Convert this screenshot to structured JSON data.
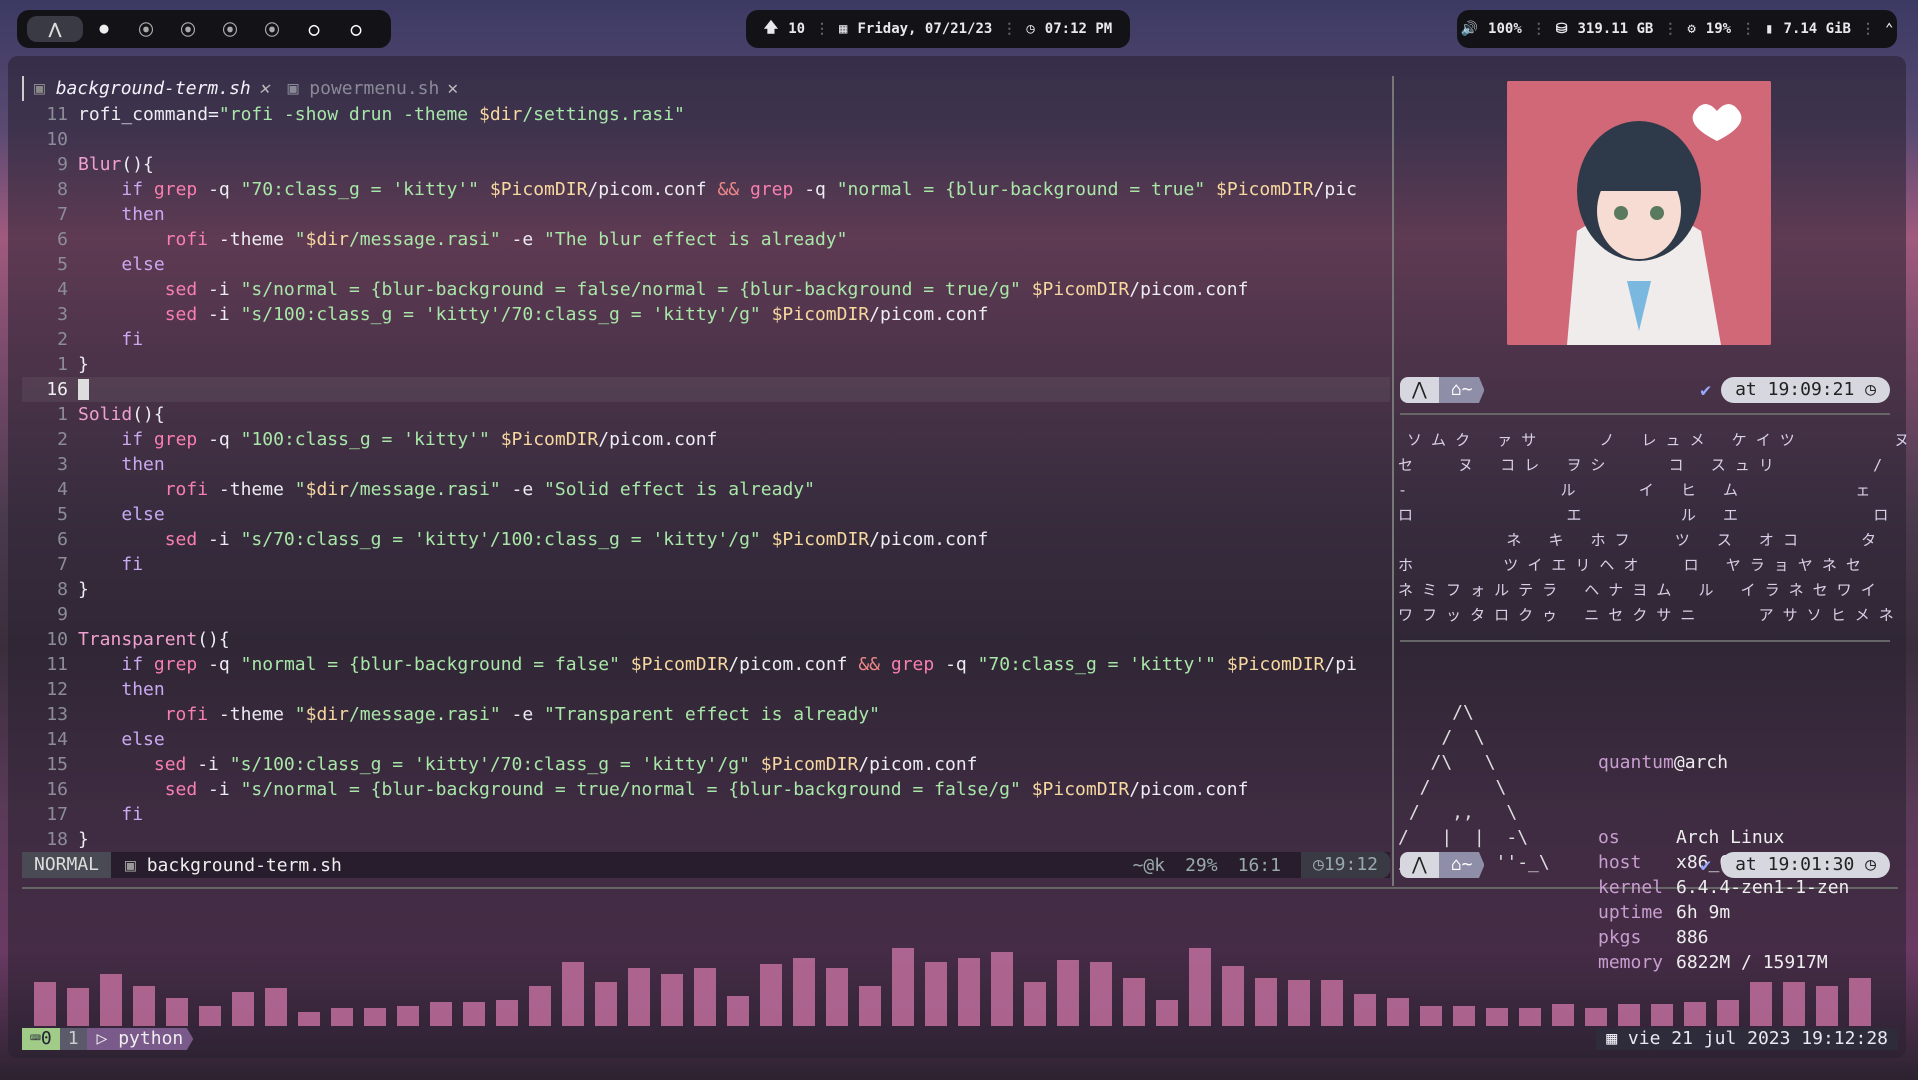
{
  "topbar": {
    "arch_icon": "arch-logo-icon",
    "workspaces": [
      "●",
      "⦿",
      "⦿",
      "⦿",
      "⦿",
      "○",
      "○"
    ],
    "updates": "10",
    "date": "Friday, 07/21/23",
    "time": "07:12 PM",
    "volume": "100%",
    "disk": "319.11 GB",
    "cpu": "19%",
    "ram": "7.14 GiB"
  },
  "editor": {
    "tab_active": "background-term.sh",
    "tab_inactive": "powermenu.sh",
    "lines": [
      {
        "n": "11",
        "html": "rofi_command=<span class='str'>\"rofi -show drun -theme </span><span class='var'>$dir</span><span class='str'>/settings.rasi\"</span>"
      },
      {
        "n": "10",
        "html": ""
      },
      {
        "n": "9",
        "html": "<span class='fn'>Blur</span>(){"
      },
      {
        "n": "8",
        "html": "    <span class='kw'>if</span> <span class='cmd'>grep</span> -q <span class='str'>\"70:class_g = 'kitty'\"</span> <span class='var'>$PicomDIR</span>/picom.conf <span class='op'>&amp;&amp;</span> <span class='cmd'>grep</span> -q <span class='str'>\"normal = {blur-background = true\"</span> <span class='var'>$PicomDIR</span>/pic"
      },
      {
        "n": "7",
        "html": "    <span class='kw'>then</span>"
      },
      {
        "n": "6",
        "html": "        <span class='cmd'>rofi</span> -theme <span class='str'>\"</span><span class='var'>$dir</span><span class='str'>/message.rasi\"</span> -e <span class='str'>\"The blur effect is already\"</span>"
      },
      {
        "n": "5",
        "html": "    <span class='kw'>else</span>"
      },
      {
        "n": "4",
        "html": "        <span class='cmd'>sed</span> -i <span class='str'>\"s/normal = {blur-background = false/normal = {blur-background = true/g\"</span> <span class='var'>$PicomDIR</span>/picom.conf"
      },
      {
        "n": "3",
        "html": "        <span class='cmd'>sed</span> -i <span class='str'>\"s/100:class_g = 'kitty'/70:class_g = 'kitty'/g\"</span> <span class='var'>$PicomDIR</span>/picom.conf"
      },
      {
        "n": "2",
        "html": "    <span class='kw'>fi</span>"
      },
      {
        "n": "1",
        "html": "}"
      },
      {
        "n": "16",
        "html": "<span style='background:#ddd'> </span>",
        "cur": true
      },
      {
        "n": "1",
        "html": "<span class='fn'>Solid</span>(){"
      },
      {
        "n": "2",
        "html": "    <span class='kw'>if</span> <span class='cmd'>grep</span> -q <span class='str'>\"100:class_g = 'kitty'\"</span> <span class='var'>$PicomDIR</span>/picom.conf"
      },
      {
        "n": "3",
        "html": "    <span class='kw'>then</span>"
      },
      {
        "n": "4",
        "html": "        <span class='cmd'>rofi</span> -theme <span class='str'>\"</span><span class='var'>$dir</span><span class='str'>/message.rasi\"</span> -e <span class='str'>\"Solid effect is already\"</span>"
      },
      {
        "n": "5",
        "html": "    <span class='kw'>else</span>"
      },
      {
        "n": "6",
        "html": "        <span class='cmd'>sed</span> -i <span class='str'>\"s/70:class_g = 'kitty'/100:class_g = 'kitty'/g\"</span> <span class='var'>$PicomDIR</span>/picom.conf"
      },
      {
        "n": "7",
        "html": "    <span class='kw'>fi</span>"
      },
      {
        "n": "8",
        "html": "}"
      },
      {
        "n": "9",
        "html": ""
      },
      {
        "n": "10",
        "html": "<span class='fn'>Transparent</span>(){"
      },
      {
        "n": "11",
        "html": "    <span class='kw'>if</span> <span class='cmd'>grep</span> -q <span class='str'>\"normal = {blur-background = false\"</span> <span class='var'>$PicomDIR</span>/picom.conf <span class='op'>&amp;&amp;</span> <span class='cmd'>grep</span> -q <span class='str'>\"70:class_g = 'kitty'\"</span> <span class='var'>$PicomDIR</span>/pi"
      },
      {
        "n": "12",
        "html": "    <span class='kw'>then</span>"
      },
      {
        "n": "13",
        "html": "        <span class='cmd'>rofi</span> -theme <span class='str'>\"</span><span class='var'>$dir</span><span class='str'>/message.rasi\"</span> -e <span class='str'>\"Transparent effect is already\"</span>"
      },
      {
        "n": "14",
        "html": "    <span class='kw'>else</span>"
      },
      {
        "n": "15",
        "html": "       <span class='cmd'>sed</span> -i <span class='str'>\"s/100:class_g = 'kitty'/70:class_g = 'kitty'/g\"</span> <span class='var'>$PicomDIR</span>/picom.conf"
      },
      {
        "n": "16",
        "html": "        <span class='cmd'>sed</span> -i <span class='str'>\"s/normal = {blur-background = true/normal = {blur-background = false/g\"</span> <span class='var'>$PicomDIR</span>/picom.conf"
      },
      {
        "n": "17",
        "html": "    <span class='kw'>fi</span>"
      },
      {
        "n": "18",
        "html": "}"
      }
    ],
    "status": {
      "mode": "NORMAL",
      "file": "background-term.sh",
      "git": "~@k",
      "percent": "29%",
      "pos": "16:1",
      "clock": "19:12"
    }
  },
  "terminal": {
    "prompt1_time": "at 19:09:21",
    "prompt2_time": "at 19:01:30",
    "home": "~",
    "matrix": " ソ ム ク   ァ サ       ノ   レ ュ メ   ケ イ ツ           ヌ\nセ     ヌ   コ レ   ヲ シ       コ   ス ュ リ           /\n-                 ル       イ   ヒ   ム             ェ\nロ                 エ           ル   エ               ロ\n            ネ   キ   ホ フ     ツ   ス   オ コ       タ\nホ          ツ イ エ リ ヘ オ     ロ   ヤ ラ ョ ヤ ネ セ\nネ ミ フ ォ ル テ ラ   ヘ ナ ヨ ム   ル   イ ラ ネ セ ワ イ\nワ フ ッ タ ロ ク ゥ   ニ セ ク サ ニ       ア サ ソ ヒ メ ネ",
    "fetch": {
      "user": "quantum",
      "at": "@arch",
      "rows": [
        [
          "os",
          "Arch Linux"
        ],
        [
          "host",
          "x86_64"
        ],
        [
          "kernel",
          "6.4.4-zen1-1-zen"
        ],
        [
          "uptime",
          "6h 9m"
        ],
        [
          "pkgs",
          "886"
        ],
        [
          "memory",
          "6822M / 15917M"
        ]
      ],
      "art": "     /\\\n    /  \\\n   /\\   \\\n  /      \\\n /   ,,   \\\n/   |  |  -\\\n/_-''    ''-_\\"
    }
  },
  "visualizer": [
    44,
    38,
    52,
    40,
    28,
    20,
    34,
    38,
    14,
    18,
    18,
    20,
    24,
    24,
    26,
    40,
    64,
    44,
    58,
    52,
    58,
    30,
    62,
    68,
    58,
    40,
    78,
    64,
    68,
    74,
    44,
    66,
    64,
    48,
    26,
    78,
    60,
    48,
    46,
    46,
    32,
    28,
    20,
    20,
    18,
    18,
    22,
    18,
    22,
    22,
    24,
    26,
    44,
    44,
    40,
    48
  ],
  "tmux": {
    "session": "0",
    "window_index": "1",
    "window_name": "python",
    "datetime": "vie 21 jul 2023 19:12:28"
  }
}
